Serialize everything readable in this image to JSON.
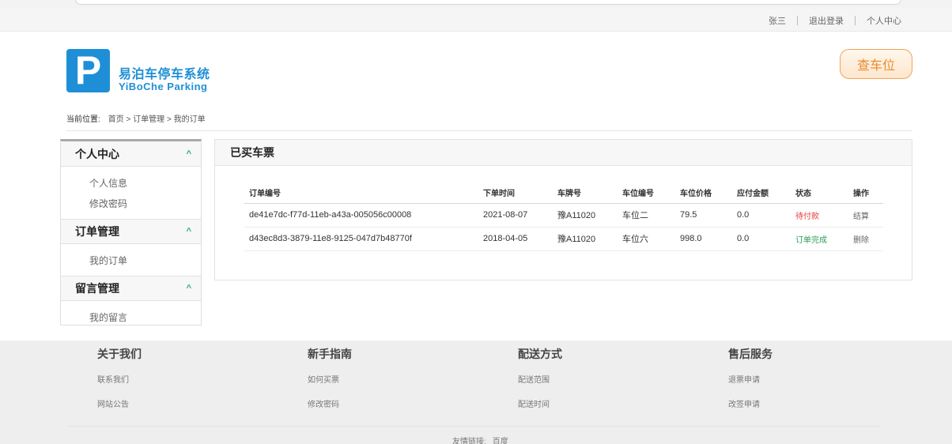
{
  "topbar": {
    "user": "张三",
    "logout": "退出登录",
    "profile": "个人中心"
  },
  "header": {
    "logo_letter": "P",
    "title_cn": "易泊车停车系统",
    "title_en": "YiBoChe  Parking",
    "find_button": "查车位"
  },
  "breadcrumb": {
    "label": "当前位置:",
    "path": "首页 > 订单管理 > 我的订单"
  },
  "sidebar": {
    "groups": [
      {
        "title": "个人中心",
        "items": [
          "个人信息",
          "修改密码"
        ]
      },
      {
        "title": "订单管理",
        "items": [
          "我的订单"
        ]
      },
      {
        "title": "留言管理",
        "items": [
          "我的留言"
        ]
      }
    ]
  },
  "orders": {
    "title": "已买车票",
    "columns": [
      "订单编号",
      "下单时间",
      "车牌号",
      "车位编号",
      "车位价格",
      "应付金额",
      "状态",
      "操作"
    ],
    "rows": [
      {
        "id": "de41e7dc-f77d-11eb-a43a-005056c00008",
        "time": "2021-08-07",
        "plate": "豫A11020",
        "space": "车位二",
        "price": "79.5",
        "due": "0.0",
        "status": "待付款",
        "action": "结算"
      },
      {
        "id": "d43ec8d3-3879-11e8-9125-047d7b48770f",
        "time": "2018-04-05",
        "plate": "豫A11020",
        "space": "车位六",
        "price": "998.0",
        "due": "0.0",
        "status": "订单完成",
        "action": "删除"
      }
    ]
  },
  "footer": {
    "columns": [
      {
        "title": "关于我们",
        "links": [
          "联系我们",
          "网站公告"
        ]
      },
      {
        "title": "新手指南",
        "links": [
          "如何买票",
          "修改密码"
        ]
      },
      {
        "title": "配送方式",
        "links": [
          "配送范围",
          "配送时间"
        ]
      },
      {
        "title": "售后服务",
        "links": [
          "退票申请",
          "改签申请"
        ]
      }
    ],
    "friend_label": "友情链接:",
    "friend_link": "百度"
  },
  "colors": {
    "brand": "#1e8fd6",
    "accent": "#e88a2d",
    "pending": "#e53e3e",
    "done": "#2e9d5a",
    "chevron": "#2fa37c"
  }
}
